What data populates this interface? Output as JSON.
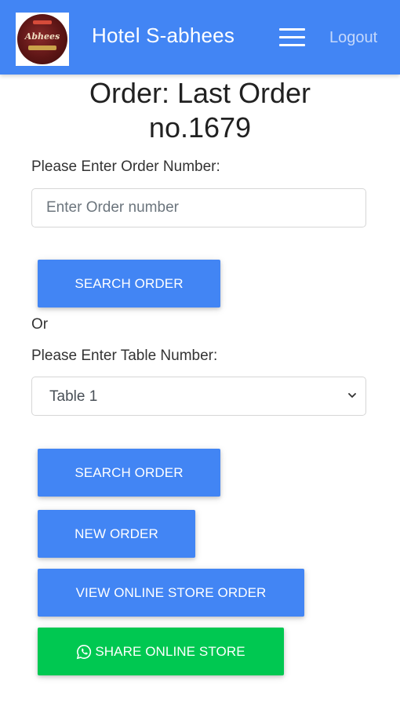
{
  "header": {
    "brand": "Hotel S-abhees",
    "logout_label": "Logout",
    "logo_text": "Abhees"
  },
  "title": {
    "line1": "Order: Last Order",
    "line2": "no.1679"
  },
  "order_search": {
    "label": "Please Enter Order Number:",
    "placeholder": "Enter Order number",
    "value": "",
    "button_label": "SEARCH ORDER"
  },
  "separator": "Or",
  "table_search": {
    "label": "Please Enter Table Number:",
    "selected": "Table 1",
    "button_label": "SEARCH ORDER"
  },
  "actions": {
    "new_order": "NEW ORDER",
    "view_online_store": "VIEW ONLINE STORE ORDER",
    "share_online_store": "SHARE ONLINE STORE"
  },
  "colors": {
    "primary": "#4285f4",
    "success": "#00c851",
    "logout_text": "#c5d8fb"
  },
  "icons": {
    "menu": "hamburger-icon",
    "select_arrow": "chevron-down-icon",
    "share": "whatsapp-icon"
  }
}
